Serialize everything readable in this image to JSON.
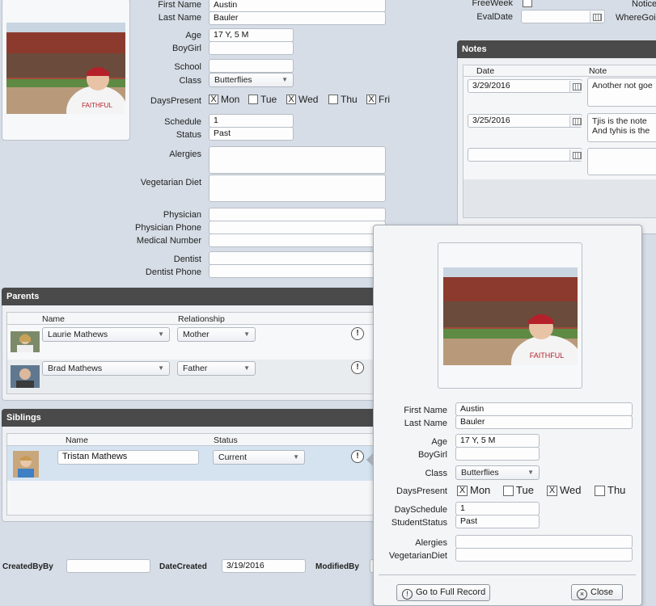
{
  "student": {
    "first_name_label": "First Name",
    "first_name": "Austin",
    "last_name_label": "Last Name",
    "last_name": "Bauler",
    "age_label": "Age",
    "age": "17 Y, 5 M",
    "boygirl_label": "BoyGirl",
    "boygirl": "",
    "school_label": "School",
    "school": "",
    "class_label": "Class",
    "class": "Butterflies",
    "days_label": "DaysPresent",
    "days": [
      {
        "label": "Mon",
        "checked": true,
        "mark": "X"
      },
      {
        "label": "Tue",
        "checked": false,
        "mark": ""
      },
      {
        "label": "Wed",
        "checked": true,
        "mark": "X"
      },
      {
        "label": "Thu",
        "checked": false,
        "mark": ""
      },
      {
        "label": "Fri",
        "checked": true,
        "mark": "X"
      }
    ],
    "schedule_label": "Schedule",
    "schedule": "1",
    "status_label": "Status",
    "status": "Past",
    "alergies_label": "Alergies",
    "vegetarian_label": "Vegetarian Diet",
    "physician_label": "Physician",
    "physician_phone_label": "Physician Phone",
    "medical_number_label": "Medical Number",
    "dentist_label": "Dentist",
    "dentist_phone_label": "Dentist Phone"
  },
  "top_right": {
    "freeweek_label": "FreeWeek",
    "evaldate_label": "EvalDate",
    "notice_label": "Notice",
    "wheregoing_label": "WhereGoi"
  },
  "notes": {
    "title": "Notes",
    "col_date": "Date",
    "col_note": "Note",
    "rows": [
      {
        "date": "3/29/2016",
        "note_line1": "Another not goe",
        "note_line2": ""
      },
      {
        "date": "3/25/2016",
        "note_line1": "Tjis is the note",
        "note_line2": "And tyhis is the"
      },
      {
        "date": "",
        "note_line1": "",
        "note_line2": ""
      }
    ]
  },
  "parents": {
    "title": "Parents",
    "col_name": "Name",
    "col_relationship": "Relationship",
    "rows": [
      {
        "name": "Laurie Mathews",
        "relationship": "Mother"
      },
      {
        "name": "Brad Mathews",
        "relationship": "Father"
      }
    ]
  },
  "siblings": {
    "title": "Siblings",
    "col_name": "Name",
    "col_status": "Status",
    "rows": [
      {
        "name": "Tristan Mathews",
        "status": "Current"
      }
    ]
  },
  "footer": {
    "createdby_label": "CreatedByBy",
    "createdby": "",
    "datecreated_label": "DateCreated",
    "datecreated": "3/19/2016",
    "modifiedby_label": "ModifiedBy"
  },
  "popup": {
    "first_name_label": "First Name",
    "first_name": "Austin",
    "last_name_label": "Last Name",
    "last_name": "Bauler",
    "age_label": "Age",
    "age": "17 Y, 5 M",
    "boygirl_label": "BoyGirl",
    "boygirl": "",
    "class_label": "Class",
    "class": "Butterflies",
    "days_label": "DaysPresent",
    "days": [
      {
        "label": "Mon",
        "mark": "X"
      },
      {
        "label": "Tue",
        "mark": ""
      },
      {
        "label": "Wed",
        "mark": "X"
      },
      {
        "label": "Thu",
        "mark": ""
      }
    ],
    "dayschedule_label": "DaySchedule",
    "dayschedule": "1",
    "studentstatus_label": "StudentStatus",
    "studentstatus": "Past",
    "alergies_label": "Alergies",
    "vegetarian_label": "VegetarianDiet",
    "full_record_button": "Go to Full Record",
    "close_button": "Close"
  },
  "icons": {
    "dropdown": "chevron-down-icon",
    "calendar": "calendar-icon",
    "person": "person-icon",
    "close": "close-icon"
  }
}
